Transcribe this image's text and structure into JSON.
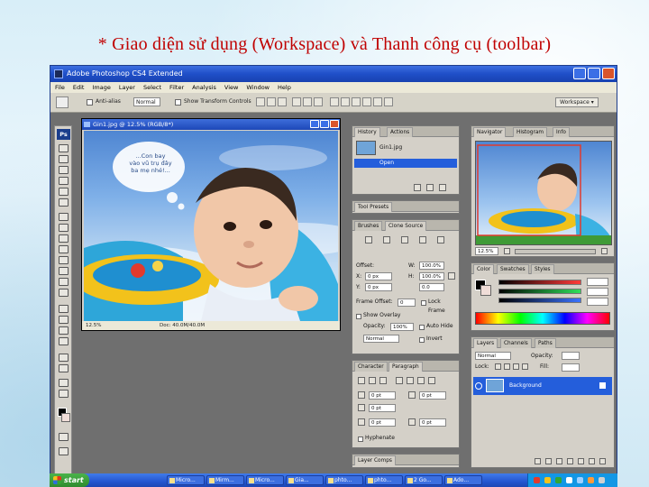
{
  "slide": {
    "title": "* Giao diện sử dụng (Workspace) và Thanh công cụ (toolbar)"
  },
  "app": {
    "title": "Adobe Photoshop CS4 Extended",
    "menu": [
      "File",
      "Edit",
      "Image",
      "Layer",
      "Select",
      "Filter",
      "Analysis",
      "View",
      "Window",
      "Help"
    ],
    "options": {
      "antialias_label": "Anti-alias",
      "style_value": "Normal",
      "transform_label": "Show Transform Controls",
      "workspace_label": "Workspace ▾"
    }
  },
  "toolbox": {
    "logo": "Ps"
  },
  "document": {
    "title": "Gin1.jpg @ 12.5% (RGB/8*)",
    "zoom": "12.5%",
    "doc_info": "Doc: 40.0M/40.0M",
    "bubble_text": [
      "...Con bay",
      "vào vũ trụ đây",
      "ba mẹ nhé!..."
    ]
  },
  "history_panel": {
    "tabs": [
      "History",
      "Actions"
    ],
    "items": [
      "Gin1.jpg",
      "Open"
    ]
  },
  "tool_presets_panel": {
    "tabs": [
      "Tool Presets"
    ]
  },
  "brushes_panel": {
    "tabs": [
      "Brushes",
      "Clone Source"
    ]
  },
  "clone_source_panel": {
    "offset_label": "Offset:",
    "x_label": "X:",
    "x_value": "0 px",
    "y_label": "Y:",
    "y_value": "0 px",
    "w_label": "W:",
    "w_value": "100.0%",
    "h_label": "H:",
    "h_value": "100.0%",
    "angle_value": "0.0",
    "frame_offset_label": "Frame Offset:",
    "frame_offset_value": "0",
    "lock_frame_label": "Lock Frame",
    "show_overlay_label": "Show Overlay",
    "opacity_label": "Opacity:",
    "opacity_value": "100%",
    "blend_value": "Normal",
    "auto_hide_label": "Auto Hide",
    "invert_label": "Invert"
  },
  "character_panel": {
    "tabs": [
      "Character",
      "Paragraph"
    ],
    "indent_values": [
      "0 pt",
      "0 pt",
      "0 pt",
      "0 pt",
      "0 pt"
    ],
    "hyphenate_label": "Hyphenate"
  },
  "layer_comps_panel": {
    "tabs": [
      "Layer Comps"
    ]
  },
  "navigator_panel": {
    "tabs": [
      "Navigator",
      "Histogram",
      "Info"
    ],
    "zoom_value": "12.5%"
  },
  "color_panel": {
    "tabs": [
      "Color",
      "Swatches",
      "Styles"
    ]
  },
  "layers_panel": {
    "tabs": [
      "Layers",
      "Channels",
      "Paths"
    ],
    "blend_mode": "Normal",
    "opacity_label": "Opacity:",
    "lock_label": "Lock:",
    "fill_label": "Fill:",
    "layer_name": "Background"
  },
  "taskbar": {
    "start_label": "start",
    "items": [
      "Micro...",
      "Mirm...",
      "Micro...",
      "Gia...",
      "phto...",
      "phto...",
      "2 Go...",
      "Ado..."
    ]
  },
  "colors": {
    "title_red": "#c00000",
    "xp_blue": "#245edb",
    "panel_gray": "#d4d0c8"
  }
}
